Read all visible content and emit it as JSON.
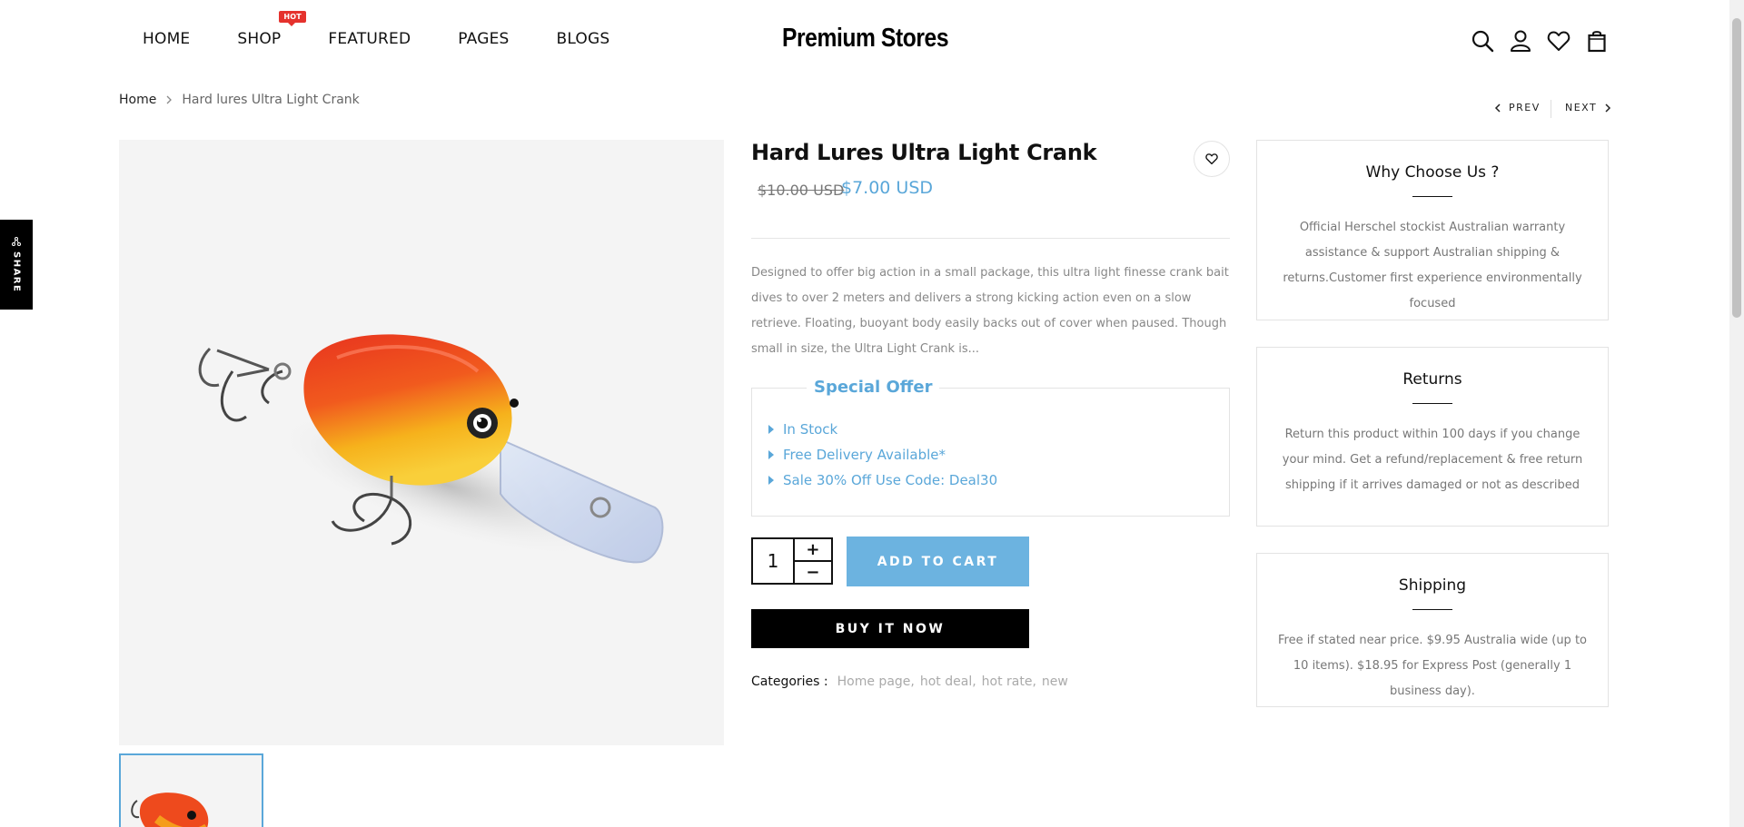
{
  "header": {
    "nav": [
      {
        "label": "HOME"
      },
      {
        "label": "SHOP",
        "badge": "HOT"
      },
      {
        "label": "FEATURED"
      },
      {
        "label": "PAGES"
      },
      {
        "label": "BLOGS"
      }
    ],
    "logo": "Premium Stores",
    "icons": [
      "search-icon",
      "account-icon",
      "wishlist-icon",
      "cart-icon"
    ]
  },
  "breadcrumb": {
    "home": "Home",
    "current": "Hard lures Ultra Light Crank"
  },
  "pager": {
    "prev": "PREV",
    "next": "NEXT"
  },
  "share": {
    "label": "SHARE"
  },
  "product": {
    "title": "Hard Lures Ultra Light Crank",
    "price_old": "$10.00 USD",
    "price_new": "$7.00 USD",
    "description": "Designed to offer big action in a small package, this ultra light finesse crank bait dives to over 2 meters and delivers a strong kicking action even on a slow retrieve. Floating, buoyant body easily backs out of cover when paused. Though small in size, the Ultra Light Crank is...",
    "offer": {
      "title": "Special Offer",
      "items": [
        "In Stock",
        "Free Delivery Available*",
        "Sale 30% Off Use Code: Deal30"
      ]
    },
    "quantity": "1",
    "qty_plus": "+",
    "qty_minus": "−",
    "add_to_cart": "ADD TO CART",
    "buy_now": "BUY IT NOW",
    "categories_label": "Categories :",
    "categories": [
      "Home page,",
      "hot deal,",
      "hot rate,",
      "new"
    ]
  },
  "boxes": [
    {
      "title": "Why Choose Us ?",
      "text": "Official Herschel stockist Australian warranty assistance & support Australian shipping & returns.Customer first experience environmentally focused"
    },
    {
      "title": "Returns",
      "text": "Return this product within 100 days if you change your mind. Get a refund/replacement & free return shipping if it arrives damaged or not as described"
    },
    {
      "title": "Shipping",
      "text": "Free if stated near price. $9.95 Australia wide (up to 10 items). $18.95 for Express Post (generally 1 business day)."
    }
  ],
  "colors": {
    "accent": "#5aa7d9",
    "button_blue": "#6cb3e0",
    "hot_badge": "#e5322d",
    "lure_red": "#e8341f",
    "lure_yellow": "#f6b21c"
  }
}
